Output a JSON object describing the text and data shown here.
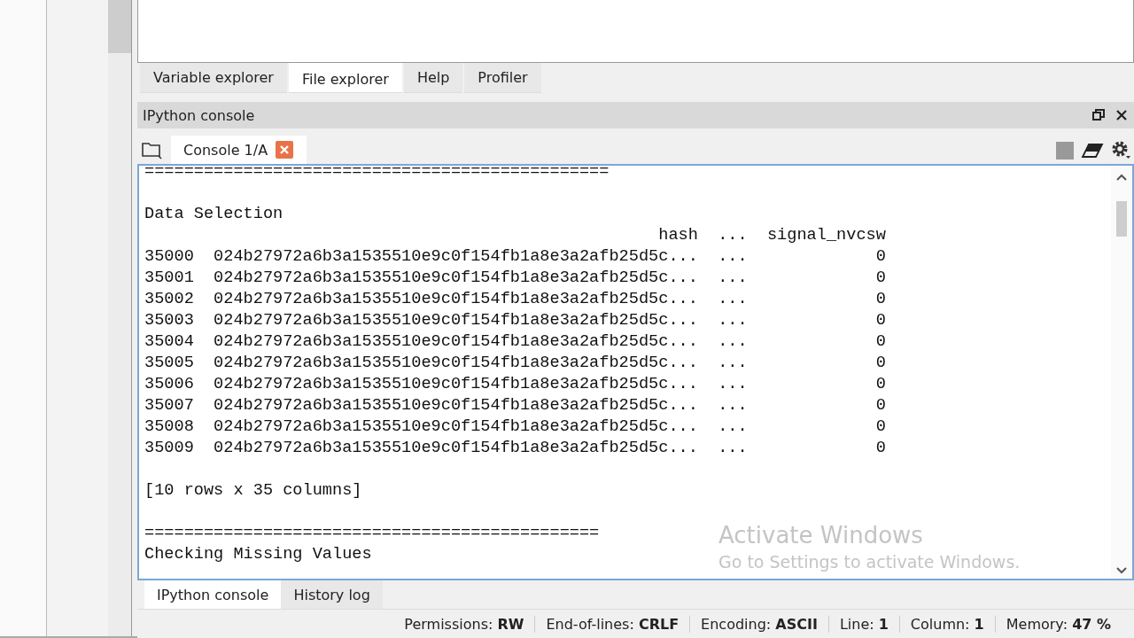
{
  "top_tabs": [
    {
      "label": "Variable explorer",
      "selected": false
    },
    {
      "label": "File explorer",
      "selected": true
    },
    {
      "label": "Help",
      "selected": false
    },
    {
      "label": "Profiler",
      "selected": false
    }
  ],
  "pane": {
    "title": "IPython console"
  },
  "console_tabs": [
    {
      "label": "Console 1/A",
      "selected": true
    }
  ],
  "console": {
    "blocks": [
      {
        "lines": [
          "==============================================="
        ]
      },
      {
        "lines": [
          "Data Selection",
          "                                                    hash  ...  signal_nvcsw",
          "35000  024b27972a6b3a1535510e9c0f154fb1a8e3a2afb25d5c...  ...             0",
          "35001  024b27972a6b3a1535510e9c0f154fb1a8e3a2afb25d5c...  ...             0",
          "35002  024b27972a6b3a1535510e9c0f154fb1a8e3a2afb25d5c...  ...             0",
          "35003  024b27972a6b3a1535510e9c0f154fb1a8e3a2afb25d5c...  ...             0",
          "35004  024b27972a6b3a1535510e9c0f154fb1a8e3a2afb25d5c...  ...             0",
          "35005  024b27972a6b3a1535510e9c0f154fb1a8e3a2afb25d5c...  ...             0",
          "35006  024b27972a6b3a1535510e9c0f154fb1a8e3a2afb25d5c...  ...             0",
          "35007  024b27972a6b3a1535510e9c0f154fb1a8e3a2afb25d5c...  ...             0",
          "35008  024b27972a6b3a1535510e9c0f154fb1a8e3a2afb25d5c...  ...             0",
          "35009  024b27972a6b3a1535510e9c0f154fb1a8e3a2afb25d5c...  ...             0"
        ]
      },
      {
        "lines": [
          "[10 rows x 35 columns]"
        ]
      },
      {
        "lines": [
          "==============================================",
          "Checking Missing Values"
        ]
      }
    ]
  },
  "bottom_tabs": [
    {
      "label": "IPython console",
      "selected": true
    },
    {
      "label": "History log",
      "selected": false
    }
  ],
  "status_bar": [
    "Permissions: **RW**",
    "End-of-lines: **CRLF**",
    "Encoding: **ASCII**",
    "Line: **1**",
    "Column: **1**",
    "Memory: **47 %**"
  ],
  "os_notice": {
    "title": "Activate Windows",
    "subtitle": "Go to Settings to activate Windows."
  }
}
